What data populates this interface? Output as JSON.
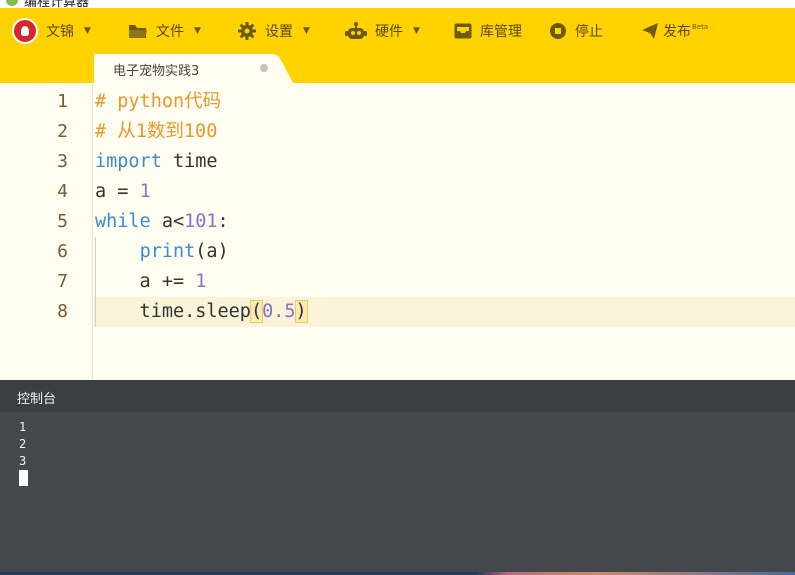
{
  "window": {
    "title": "编程计算器"
  },
  "menubar": {
    "items": [
      {
        "label": "文锦",
        "icon": "user-avatar",
        "has_dropdown": true
      },
      {
        "label": "文件",
        "icon": "folder-icon",
        "has_dropdown": true
      },
      {
        "label": "设置",
        "icon": "gear-icon",
        "has_dropdown": true
      },
      {
        "label": "硬件",
        "icon": "robot-icon",
        "has_dropdown": true
      },
      {
        "label": "库管理",
        "icon": "inbox-icon",
        "has_dropdown": false
      },
      {
        "label": "停止",
        "icon": "stop-icon",
        "has_dropdown": false
      },
      {
        "label": "发布",
        "icon": "paper-plane-icon",
        "has_dropdown": false,
        "badge": "Beta"
      }
    ],
    "accent_color": "#ffd200"
  },
  "tabs": [
    {
      "label": "电子宠物实践3",
      "modified": true,
      "active": true
    }
  ],
  "editor": {
    "line_numbers": [
      "1",
      "2",
      "3",
      "4",
      "5",
      "6",
      "7",
      "8"
    ],
    "active_line": 8,
    "lines": [
      {
        "segments": [
          {
            "text": "# python代码",
            "type": "comment"
          }
        ]
      },
      {
        "segments": [
          {
            "text": "# 从1数到100",
            "type": "comment"
          }
        ]
      },
      {
        "segments": [
          {
            "text": "import",
            "type": "keyword"
          },
          {
            "text": " time",
            "type": "plain"
          }
        ]
      },
      {
        "segments": [
          {
            "text": "a = ",
            "type": "plain"
          },
          {
            "text": "1",
            "type": "number"
          }
        ]
      },
      {
        "segments": [
          {
            "text": "while",
            "type": "keyword"
          },
          {
            "text": " a<",
            "type": "plain"
          },
          {
            "text": "101",
            "type": "number"
          },
          {
            "text": ":",
            "type": "plain"
          }
        ]
      },
      {
        "segments": [
          {
            "text": "    ",
            "type": "plain"
          },
          {
            "text": "print",
            "type": "builtin"
          },
          {
            "text": "(a)",
            "type": "plain"
          }
        ]
      },
      {
        "segments": [
          {
            "text": "    a += ",
            "type": "plain"
          },
          {
            "text": "1",
            "type": "number"
          }
        ]
      },
      {
        "segments": [
          {
            "text": "    time.sleep",
            "type": "plain"
          },
          {
            "text": "(",
            "type": "bracket"
          },
          {
            "text": "0.5",
            "type": "number"
          },
          {
            "text": ")",
            "type": "bracket"
          }
        ]
      }
    ]
  },
  "console": {
    "title": "控制台",
    "output": [
      "1",
      "2",
      "3"
    ]
  }
}
